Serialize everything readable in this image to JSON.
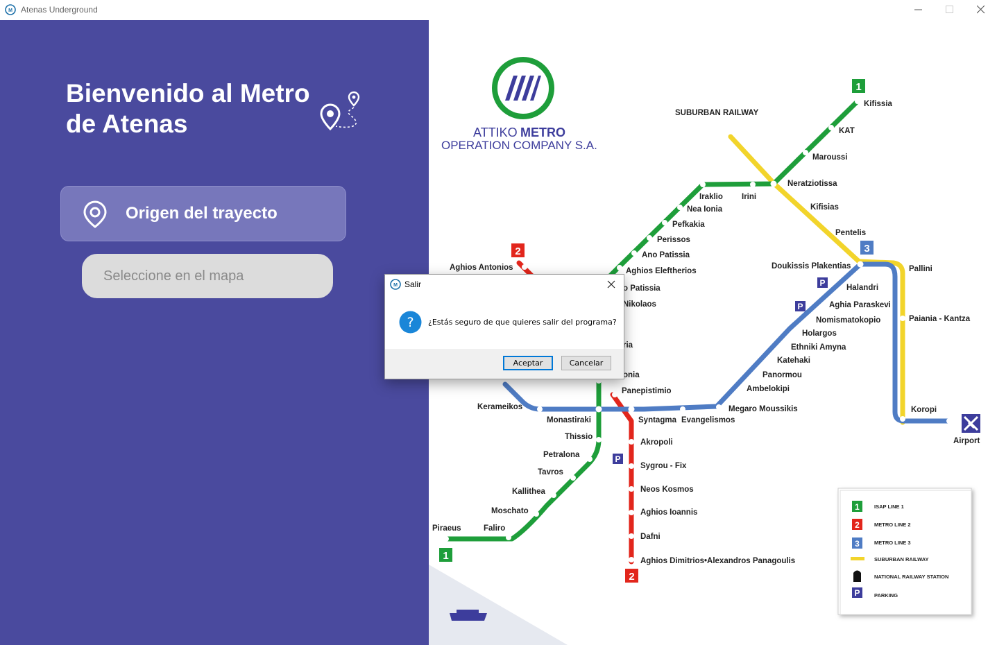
{
  "window": {
    "title": "Atenas Underground",
    "controls": [
      "minimize-icon",
      "maximize-icon",
      "close-icon"
    ]
  },
  "sidebar": {
    "welcome_title": "Bienvenido al Metro de Atenas",
    "origin_label": "Origen del trayecto",
    "select_placeholder": "Seleccione en el mapa",
    "icons": [
      "route-map-icon",
      "location-pin-icon"
    ]
  },
  "map": {
    "logo": {
      "attiko": "ATTIKO",
      "metro": "METRO",
      "company": "OPERATION COMPANY S.A."
    },
    "suburban_label": "SUBURBAN RAILWAY",
    "line_badges": {
      "line1": "1",
      "line2": "2",
      "line3": "3"
    },
    "stations": {
      "kifissia": "Kifissia",
      "kat": "KAT",
      "maroussi": "Maroussi",
      "neratziotissa": "Neratziotissa",
      "irini": "Irini",
      "iraklio": "Iraklio",
      "nea_ionia": "Nea Ionia",
      "pefkakia": "Pefkakia",
      "perissos": "Perissos",
      "ano_patissia": "Ano Patissia",
      "aghios_eleftherios": "Aghios Eleftherios",
      "patissia": "o Patissia",
      "nikolaos": "Nikolaos",
      "kifisias": "Kifisias",
      "pentelis": "Pentelis",
      "doukissis": "Doukissis Plakentias",
      "pallini": "Pallini",
      "halandri": "Halandri",
      "aghia_paraskevi": "Aghia Paraskevi",
      "nomismatokopio": "Nomismatokopio",
      "holargos": "Holargos",
      "ethniki_amyna": "Ethniki Amyna",
      "katehaki": "Katehaki",
      "panormou": "Panormou",
      "ambelokipi": "Ambelokipi",
      "megaro": "Megaro Moussikis",
      "paiania": "Paiania - Kantza",
      "koropi": "Koropi",
      "airport": "Airport",
      "aghios_antonios": "Aghios Antonios",
      "ria": "ria",
      "onia": "onia",
      "panepistimio": "Panepistimio",
      "kerameikos": "Kerameikos",
      "monastiraki": "Monastiraki",
      "syntagma": "Syntagma",
      "evangelismos": "Evangelismos",
      "thissio": "Thissio",
      "petralona": "Petralona",
      "tavros": "Tavros",
      "kallithea": "Kallithea",
      "moschato": "Moschato",
      "faliro": "Faliro",
      "piraeus": "Piraeus",
      "akropoli": "Akropoli",
      "sygrou": "Sygrou - Fix",
      "neos_kosmos": "Neos Kosmos",
      "aghios_ioannis": "Aghios Ioannis",
      "dafni": "Dafni",
      "aghios_dimitrios": "Aghios Dimitrios•Alexandros Panagoulis"
    },
    "legend": [
      {
        "badge": "1",
        "label": "ISAP LINE 1"
      },
      {
        "badge": "2",
        "label": "METRO LINE 2"
      },
      {
        "badge": "3",
        "label": "METRO LINE 3"
      },
      {
        "badge": "",
        "label": "SUBURBAN RAILWAY"
      },
      {
        "badge": "",
        "label": "NATIONAL RAILWAY STATION"
      },
      {
        "badge": "P",
        "label": "PARKING"
      }
    ],
    "parking_label": "P",
    "colors": {
      "line1": "#1e9e3a",
      "line2": "#e2261c",
      "line3": "#4f7cc4",
      "suburban": "#f2d42b",
      "panel": "#4a4a9e"
    }
  },
  "dialog": {
    "title": "Salir",
    "message": "¿Estás seguro de que quieres salir del programa?",
    "ok_label": "Aceptar",
    "cancel_label": "Cancelar",
    "icon": "question-icon"
  }
}
